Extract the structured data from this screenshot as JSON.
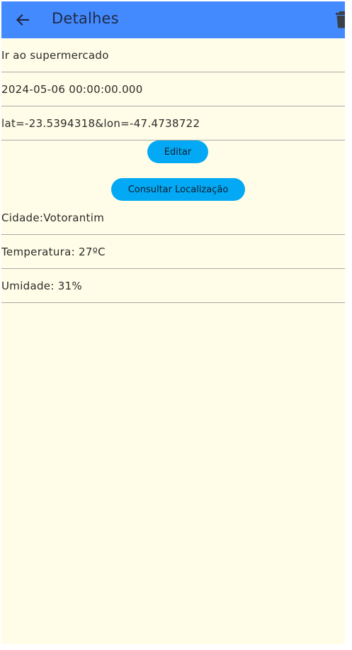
{
  "appbar": {
    "title": "Detalhes",
    "back_icon": "arrow-left-icon",
    "delete_icon": "trash-icon",
    "background_color": "#448aff"
  },
  "details": {
    "description": "Ir ao supermercado",
    "date": "2024-05-06 00:00:00.000",
    "location": "lat=-23.5394318&lon=-47.4738722"
  },
  "buttons": {
    "edit_label": "Editar",
    "check_location_label": "Consultar Localização",
    "color": "#03a9f4"
  },
  "weather": {
    "city": "Cidade:Votorantim",
    "temperature": "Temperatura: 27ºC",
    "humidity": "Umidade: 31%"
  },
  "page_background": "#fffde7"
}
